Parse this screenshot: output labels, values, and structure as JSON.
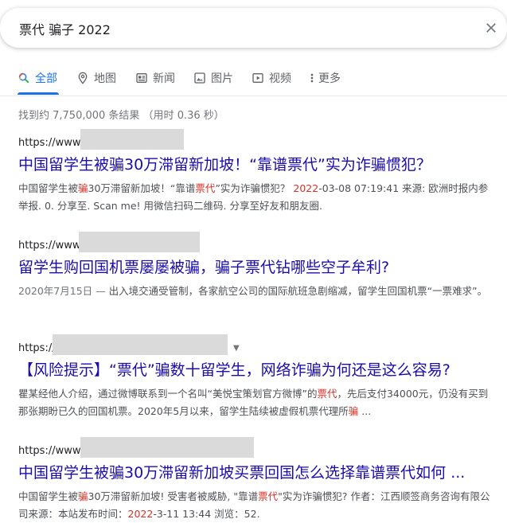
{
  "search": {
    "query": "票代 骗子 2022"
  },
  "tabs": [
    {
      "label": "全部",
      "icon": "search-icon",
      "active": true
    },
    {
      "label": "地图",
      "icon": "map-pin-icon"
    },
    {
      "label": "新闻",
      "icon": "news-icon"
    },
    {
      "label": "图片",
      "icon": "image-icon"
    },
    {
      "label": "视频",
      "icon": "video-icon"
    },
    {
      "label": "更多",
      "icon": "more-vert-icon"
    }
  ],
  "stats": "找到约 7,750,000 条结果 （用时 0.36 秒）",
  "results": [
    {
      "url": "https://www.",
      "title": "中国留学生被骗30万滞留新加坡！“靠谱票代”实为诈骗惯犯？",
      "snippet": [
        {
          "t": "中国留学生被"
        },
        {
          "t": "骗",
          "hl": true
        },
        {
          "t": "30万滞留新加坡！“靠谱"
        },
        {
          "t": "票代",
          "hl": true
        },
        {
          "t": "”实为诈骗惯犯？ "
        },
        {
          "t": "2022",
          "hl": true
        },
        {
          "t": "-03-08 07:19:41 来源: 欧洲时报内参 举报. 0. 分享至. Scan me! 用微信扫码二维码. 分享至好友和朋友圈."
        }
      ]
    },
    {
      "url": "https://www.",
      "title": "留学生购回国机票屡屡被骗，骗子票代钻哪些空子牟利?",
      "snippet": [
        {
          "t": "2020年7月15日 — ",
          "date": true
        },
        {
          "t": "出入境交通受管制，各家航空公司的国际航班急剧缩减，留学生回国机票“一票难求”。"
        }
      ]
    },
    {
      "url": "https://",
      "title": "【风险提示】“票代”骗数十留学生，网络诈骗为何还是这么容易?",
      "snippet": [
        {
          "t": "瞿某经他人介绍，通过微博联系到一个名叫“美悦宝策划官方微博”的"
        },
        {
          "t": "票代",
          "hl": true
        },
        {
          "t": "，先后支付34000元，仍没有买到那张期盼已久的回国机票。2020年5月以来，留学生陆续被虚假机票代理所"
        },
        {
          "t": "骗",
          "hl": true
        },
        {
          "t": " ..."
        }
      ]
    },
    {
      "url": "https://www.",
      "title": "中国留学生被骗30万滞留新加坡买票回国怎么选择靠谱票代如何 ...",
      "snippet": [
        {
          "t": "中国留学生被"
        },
        {
          "t": "骗",
          "hl": true
        },
        {
          "t": "30万滞留新加坡! 受害者被威胁, \"靠谱"
        },
        {
          "t": "票代",
          "hl": true
        },
        {
          "t": "\"实为诈骗惯犯? 作者：江西顺签商务咨询有限公司来源：本站发布时间："
        },
        {
          "t": "2022",
          "hl": true
        },
        {
          "t": "-3-11 13:44 浏览：52."
        }
      ]
    }
  ]
}
